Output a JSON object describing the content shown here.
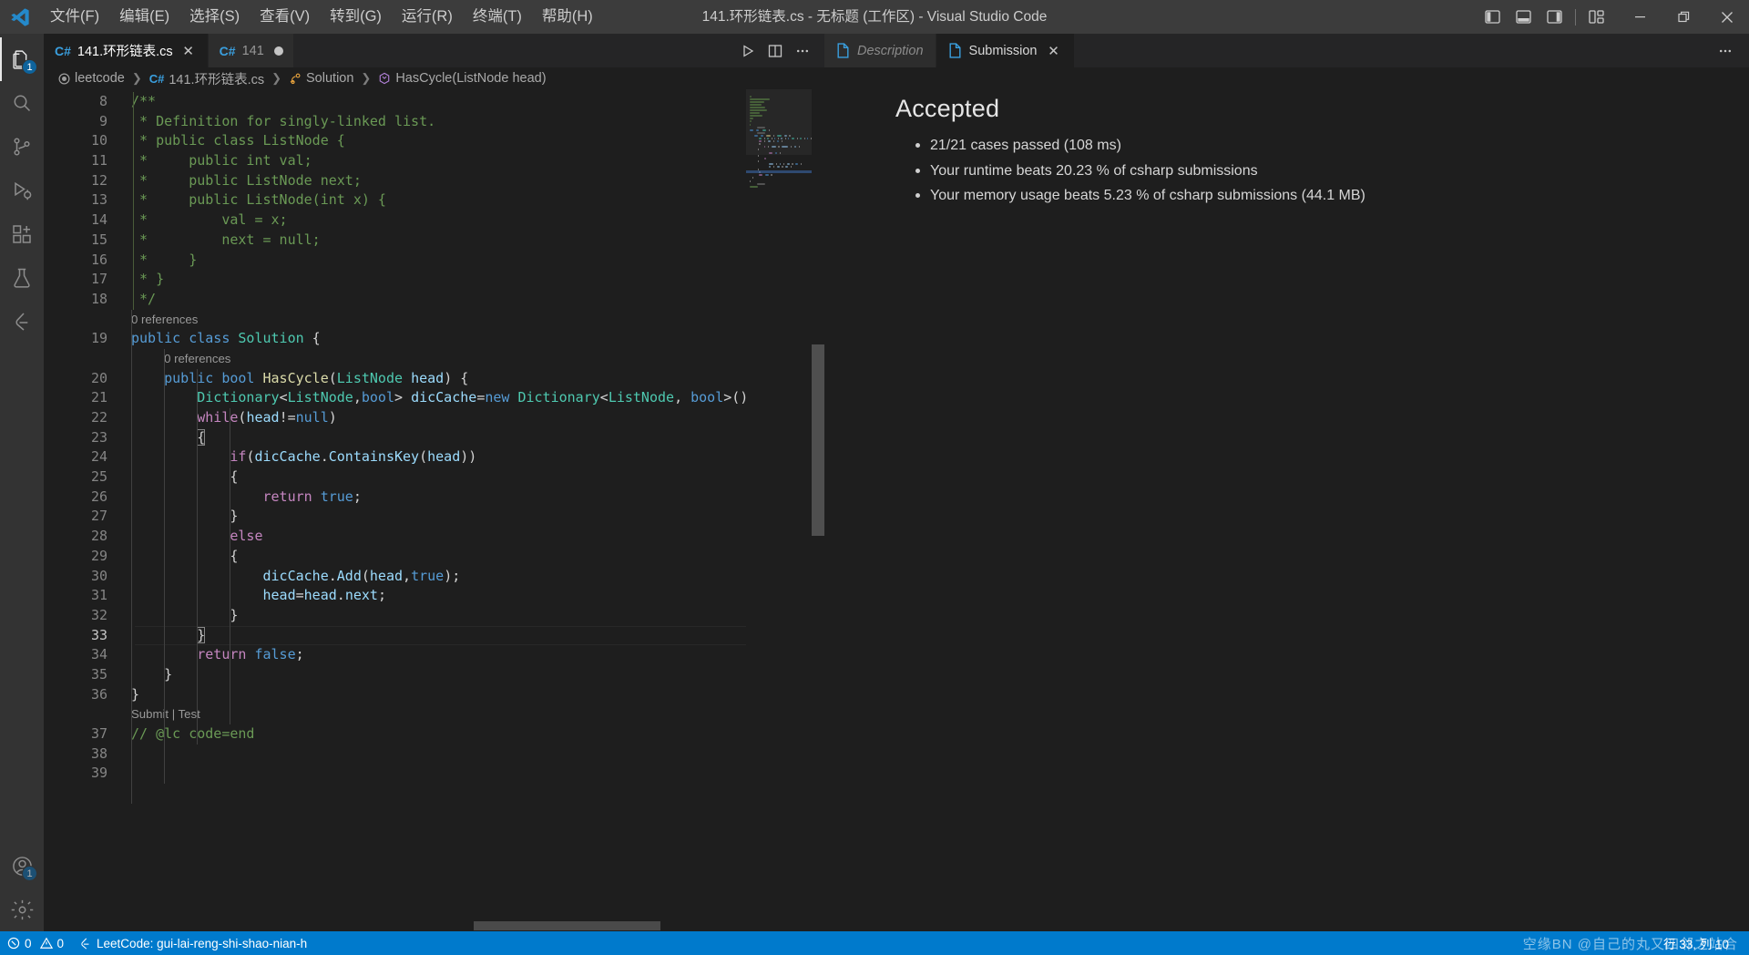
{
  "titlebar": {
    "menus": [
      "文件(F)",
      "编辑(E)",
      "选择(S)",
      "查看(V)",
      "转到(G)",
      "运行(R)",
      "终端(T)",
      "帮助(H)"
    ],
    "window_title": "141.环形链表.cs - 无标题 (工作区) - Visual Studio Code",
    "layout_buttons": [
      "toggle-primary-sidebar",
      "toggle-panel",
      "toggle-secondary-sidebar",
      "customize-layout"
    ],
    "window_buttons": [
      "minimize",
      "restore",
      "close"
    ]
  },
  "activitybar": {
    "items": [
      {
        "name": "explorer",
        "badge": "1"
      },
      {
        "name": "search",
        "badge": ""
      },
      {
        "name": "source-control",
        "badge": ""
      },
      {
        "name": "run-and-debug",
        "badge": ""
      },
      {
        "name": "extensions",
        "badge": ""
      },
      {
        "name": "testing",
        "badge": ""
      },
      {
        "name": "leetcode",
        "badge": ""
      }
    ],
    "bottom_items": [
      {
        "name": "accounts",
        "badge": "1"
      },
      {
        "name": "manage-settings",
        "badge": ""
      }
    ]
  },
  "editor": {
    "tabs": [
      {
        "icon": "C#",
        "label": "141.环形链表.cs",
        "active": true,
        "dirty": false,
        "closable": true
      },
      {
        "icon": "C#",
        "label": "141",
        "active": false,
        "dirty": true,
        "closable": false
      }
    ],
    "tab_actions": [
      "run-code",
      "split-editor",
      "more-actions"
    ],
    "breadcrumbs": [
      {
        "icon": "target",
        "label": "leetcode"
      },
      {
        "icon": "C#",
        "label": "141.环形链表.cs"
      },
      {
        "icon": "class",
        "label": "Solution"
      },
      {
        "icon": "method",
        "label": "HasCycle(ListNode head)"
      }
    ],
    "cursor": {
      "line": 33,
      "column": 10
    },
    "lines": [
      {
        "n": 8,
        "indent": 0,
        "tokens": [
          {
            "t": "/**",
            "c": "c-comment"
          }
        ]
      },
      {
        "n": 9,
        "indent": 0,
        "tokens": [
          {
            "t": " * Definition for singly-linked list.",
            "c": "c-comment"
          }
        ]
      },
      {
        "n": 10,
        "indent": 0,
        "tokens": [
          {
            "t": " * public class ListNode {",
            "c": "c-comment"
          }
        ]
      },
      {
        "n": 11,
        "indent": 0,
        "tokens": [
          {
            "t": " *     public int val;",
            "c": "c-comment"
          }
        ]
      },
      {
        "n": 12,
        "indent": 0,
        "tokens": [
          {
            "t": " *     public ListNode next;",
            "c": "c-comment"
          }
        ]
      },
      {
        "n": 13,
        "indent": 0,
        "tokens": [
          {
            "t": " *     public ListNode(int x) {",
            "c": "c-comment"
          }
        ]
      },
      {
        "n": 14,
        "indent": 0,
        "tokens": [
          {
            "t": " *         val = x;",
            "c": "c-comment"
          }
        ]
      },
      {
        "n": 15,
        "indent": 0,
        "tokens": [
          {
            "t": " *         next = null;",
            "c": "c-comment"
          }
        ]
      },
      {
        "n": 16,
        "indent": 0,
        "tokens": [
          {
            "t": " *     }",
            "c": "c-comment"
          }
        ]
      },
      {
        "n": 17,
        "indent": 0,
        "tokens": [
          {
            "t": " * }",
            "c": "c-comment"
          }
        ]
      },
      {
        "n": 18,
        "indent": 0,
        "tokens": [
          {
            "t": " */",
            "c": "c-comment"
          }
        ]
      },
      {
        "n": null,
        "codelens": "0 references",
        "pad": 0
      },
      {
        "n": 19,
        "indent": 0,
        "tokens": [
          {
            "t": "public",
            "c": "c-key"
          },
          {
            "t": " ",
            "c": "c-plain"
          },
          {
            "t": "class",
            "c": "c-key"
          },
          {
            "t": " ",
            "c": "c-plain"
          },
          {
            "t": "Solution",
            "c": "c-type"
          },
          {
            "t": " {",
            "c": "c-plain"
          }
        ]
      },
      {
        "n": null,
        "codelens": "0 references",
        "pad": 1
      },
      {
        "n": 20,
        "indent": 1,
        "tokens": [
          {
            "t": "    ",
            "c": "c-plain"
          },
          {
            "t": "public",
            "c": "c-key"
          },
          {
            "t": " ",
            "c": "c-plain"
          },
          {
            "t": "bool",
            "c": "c-key"
          },
          {
            "t": " ",
            "c": "c-plain"
          },
          {
            "t": "HasCycle",
            "c": "c-fn"
          },
          {
            "t": "(",
            "c": "c-plain"
          },
          {
            "t": "ListNode",
            "c": "c-type"
          },
          {
            "t": " ",
            "c": "c-plain"
          },
          {
            "t": "head",
            "c": "c-var"
          },
          {
            "t": ") {",
            "c": "c-plain"
          }
        ]
      },
      {
        "n": 21,
        "indent": 2,
        "tokens": [
          {
            "t": "        ",
            "c": "c-plain"
          },
          {
            "t": "Dictionary",
            "c": "c-type"
          },
          {
            "t": "<",
            "c": "c-plain"
          },
          {
            "t": "ListNode",
            "c": "c-type"
          },
          {
            "t": ",",
            "c": "c-plain"
          },
          {
            "t": "bool",
            "c": "c-key"
          },
          {
            "t": "> ",
            "c": "c-plain"
          },
          {
            "t": "dicCache",
            "c": "c-var"
          },
          {
            "t": "=",
            "c": "c-plain"
          },
          {
            "t": "new",
            "c": "c-key"
          },
          {
            "t": " ",
            "c": "c-plain"
          },
          {
            "t": "Dictionary",
            "c": "c-type"
          },
          {
            "t": "<",
            "c": "c-plain"
          },
          {
            "t": "ListNode",
            "c": "c-type"
          },
          {
            "t": ", ",
            "c": "c-plain"
          },
          {
            "t": "bool",
            "c": "c-key"
          },
          {
            "t": ">();",
            "c": "c-plain"
          }
        ]
      },
      {
        "n": 22,
        "indent": 2,
        "tokens": [
          {
            "t": "        ",
            "c": "c-plain"
          },
          {
            "t": "while",
            "c": "c-ctrl"
          },
          {
            "t": "(",
            "c": "c-plain"
          },
          {
            "t": "head",
            "c": "c-var"
          },
          {
            "t": "!=",
            "c": "c-plain"
          },
          {
            "t": "null",
            "c": "c-key"
          },
          {
            "t": ")",
            "c": "c-plain"
          }
        ]
      },
      {
        "n": 23,
        "indent": 2,
        "tokens": [
          {
            "t": "        ",
            "c": "c-plain"
          },
          {
            "t": "{",
            "c": "c-plain",
            "box": true
          }
        ]
      },
      {
        "n": 24,
        "indent": 3,
        "tokens": [
          {
            "t": "            ",
            "c": "c-plain"
          },
          {
            "t": "if",
            "c": "c-ctrl"
          },
          {
            "t": "(",
            "c": "c-plain"
          },
          {
            "t": "dicCache",
            "c": "c-var"
          },
          {
            "t": ".",
            "c": "c-plain"
          },
          {
            "t": "ContainsKey",
            "c": "c-var"
          },
          {
            "t": "(",
            "c": "c-plain"
          },
          {
            "t": "head",
            "c": "c-var"
          },
          {
            "t": "))",
            "c": "c-plain"
          }
        ]
      },
      {
        "n": 25,
        "indent": 3,
        "tokens": [
          {
            "t": "            {",
            "c": "c-plain"
          }
        ]
      },
      {
        "n": 26,
        "indent": 4,
        "tokens": [
          {
            "t": "                ",
            "c": "c-plain"
          },
          {
            "t": "return",
            "c": "c-ctrl"
          },
          {
            "t": " ",
            "c": "c-plain"
          },
          {
            "t": "true",
            "c": "c-key"
          },
          {
            "t": ";",
            "c": "c-plain"
          }
        ]
      },
      {
        "n": 27,
        "indent": 3,
        "tokens": [
          {
            "t": "            }",
            "c": "c-plain"
          }
        ]
      },
      {
        "n": 28,
        "indent": 3,
        "tokens": [
          {
            "t": "            ",
            "c": "c-plain"
          },
          {
            "t": "else",
            "c": "c-ctrl"
          }
        ]
      },
      {
        "n": 29,
        "indent": 3,
        "tokens": [
          {
            "t": "            {",
            "c": "c-plain"
          }
        ]
      },
      {
        "n": 30,
        "indent": 4,
        "tokens": [
          {
            "t": "                ",
            "c": "c-plain"
          },
          {
            "t": "dicCache",
            "c": "c-var"
          },
          {
            "t": ".",
            "c": "c-plain"
          },
          {
            "t": "Add",
            "c": "c-var"
          },
          {
            "t": "(",
            "c": "c-plain"
          },
          {
            "t": "head",
            "c": "c-var"
          },
          {
            "t": ",",
            "c": "c-plain"
          },
          {
            "t": "true",
            "c": "c-key"
          },
          {
            "t": ");",
            "c": "c-plain"
          }
        ]
      },
      {
        "n": 31,
        "indent": 4,
        "tokens": [
          {
            "t": "                ",
            "c": "c-plain"
          },
          {
            "t": "head",
            "c": "c-var"
          },
          {
            "t": "=",
            "c": "c-plain"
          },
          {
            "t": "head",
            "c": "c-var"
          },
          {
            "t": ".",
            "c": "c-plain"
          },
          {
            "t": "next",
            "c": "c-var"
          },
          {
            "t": ";",
            "c": "c-plain"
          }
        ]
      },
      {
        "n": 32,
        "indent": 3,
        "tokens": [
          {
            "t": "            }",
            "c": "c-plain"
          }
        ]
      },
      {
        "n": 33,
        "indent": 2,
        "current": true,
        "tokens": [
          {
            "t": "        ",
            "c": "c-plain"
          },
          {
            "t": "}",
            "c": "c-plain",
            "box": true
          }
        ]
      },
      {
        "n": 34,
        "indent": 2,
        "tokens": [
          {
            "t": "        ",
            "c": "c-plain"
          },
          {
            "t": "return",
            "c": "c-ctrl"
          },
          {
            "t": " ",
            "c": "c-plain"
          },
          {
            "t": "false",
            "c": "c-key"
          },
          {
            "t": ";",
            "c": "c-plain"
          }
        ]
      },
      {
        "n": 35,
        "indent": 1,
        "tokens": [
          {
            "t": "    }",
            "c": "c-plain"
          }
        ]
      },
      {
        "n": 36,
        "indent": 0,
        "tokens": [
          {
            "t": "}",
            "c": "c-plain"
          }
        ]
      },
      {
        "n": null,
        "codelens": "Submit | Test",
        "pad": 0,
        "links": [
          "Submit",
          "Test"
        ]
      },
      {
        "n": 37,
        "indent": 0,
        "tokens": [
          {
            "t": "// @lc code=end",
            "c": "c-comment"
          }
        ]
      },
      {
        "n": 38,
        "indent": 0,
        "tokens": [
          {
            "t": "",
            "c": "c-plain"
          }
        ]
      },
      {
        "n": 39,
        "indent": 0,
        "tokens": [
          {
            "t": "",
            "c": "c-plain"
          }
        ]
      }
    ]
  },
  "leetcode_panel": {
    "tabs": [
      {
        "label": "Description",
        "active": false,
        "italic": true,
        "closable": false
      },
      {
        "label": "Submission",
        "active": true,
        "italic": false,
        "closable": true
      }
    ],
    "more_actions": "…",
    "result_title": "Accepted",
    "result_items": [
      "21/21 cases passed (108 ms)",
      "Your runtime beats 20.23 % of csharp submissions",
      "Your memory usage beats 5.23 % of csharp submissions (44.1 MB)"
    ]
  },
  "statusbar": {
    "errors": "0",
    "warnings": "0",
    "leetcode_label": "LeetCode: gui-lai-reng-shi-shao-nian-h",
    "cursor_position": "行 33, 列 10",
    "watermark": "空缘BN @自己的丸又四邻之站合",
    "accent_color": "#007acc"
  }
}
